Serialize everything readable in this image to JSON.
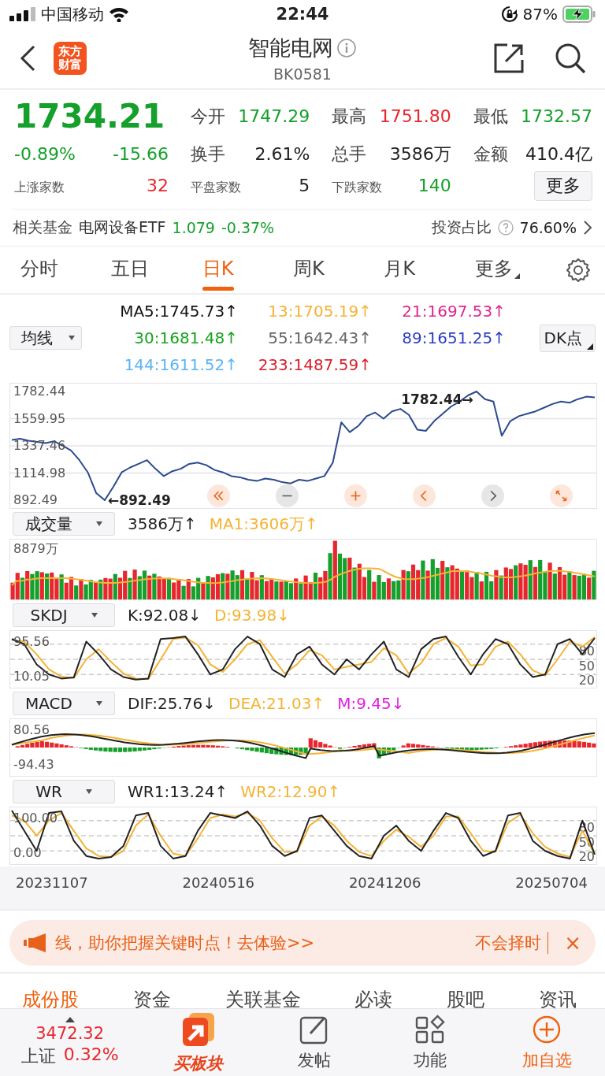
{
  "status_bar": {
    "carrier": "中国移动",
    "time": "22:44",
    "battery": "87%"
  },
  "header": {
    "logo": "东方财富",
    "title": "智能电网",
    "code": "BK0581"
  },
  "quote": {
    "price": "1734.21",
    "color": "#15a02b",
    "change_pct": "-0.89%",
    "change": "-15.66",
    "stats": [
      {
        "label": "今开",
        "value": "1747.29",
        "color": "#15a02b"
      },
      {
        "label": "最高",
        "value": "1751.80",
        "color": "#e8262d"
      },
      {
        "label": "最低",
        "value": "1732.57",
        "color": "#15a02b"
      },
      {
        "label": "换手",
        "value": "2.61%",
        "color": "#222222"
      },
      {
        "label": "总手",
        "value": "3586万",
        "color": "#222222"
      },
      {
        "label": "金额",
        "value": "410.4亿",
        "color": "#222222"
      }
    ],
    "counts": [
      {
        "label": "上涨家数",
        "value": "32",
        "color": "#e8262d"
      },
      {
        "label": "平盘家数",
        "value": "5",
        "color": "#222222"
      },
      {
        "label": "下跌家数",
        "value": "140",
        "color": "#15a02b"
      }
    ],
    "more_button": "更多"
  },
  "fund": {
    "label": "相关基金",
    "name": "电网设备ETF",
    "price": "1.079",
    "change": "-0.37%",
    "ratio_label": "投资占比",
    "ratio": "76.60%"
  },
  "tabs": [
    {
      "label": "分时",
      "selected": false
    },
    {
      "label": "五日",
      "selected": false
    },
    {
      "label": "日K",
      "selected": true
    },
    {
      "label": "周K",
      "selected": false
    },
    {
      "label": "月K",
      "selected": false
    },
    {
      "label": "更多",
      "selected": false
    }
  ],
  "ma": {
    "selector": "均线",
    "button": "DK点",
    "items": [
      {
        "text": "MA5:1745.73↑",
        "color": "#111111"
      },
      {
        "text": "13:1705.19↑",
        "color": "#f5b335"
      },
      {
        "text": "21:1697.53↑",
        "color": "#e0248c"
      },
      {
        "text": "30:1681.48↑",
        "color": "#16a31e"
      },
      {
        "text": "55:1642.43↑",
        "color": "#666666"
      },
      {
        "text": "89:1651.25↑",
        "color": "#2c3fc4"
      },
      {
        "text": "144:1611.52↑",
        "color": "#5ab4f5"
      },
      {
        "text": "233:1487.59↑",
        "color": "#d9202c"
      }
    ]
  },
  "price_chart": {
    "max_label": "1782.44→",
    "min_label": "←892.49",
    "chart_data": {
      "type": "line",
      "grid": true,
      "ylim": [
        828,
        1847
      ],
      "yticks": [
        1782.44,
        1559.95,
        1337.46,
        1114.98,
        892.49
      ],
      "series": [
        {
          "color": "#2b4a8e",
          "values": [
            1385,
            1395,
            1380,
            1370,
            1360,
            1375,
            1340,
            1300,
            1220,
            1120,
            950,
            892.49,
            1000,
            1120,
            1160,
            1190,
            1220,
            1150,
            1090,
            1130,
            1150,
            1190,
            1200,
            1180,
            1140,
            1120,
            1090,
            1080,
            1060,
            1050,
            1070,
            1060,
            1040,
            1030,
            1060,
            1050,
            1070,
            1090,
            1200,
            1530,
            1450,
            1500,
            1580,
            1610,
            1560,
            1620,
            1640,
            1590,
            1470,
            1460,
            1540,
            1600,
            1660,
            1700,
            1750,
            1782.44,
            1720,
            1700,
            1420,
            1540,
            1580,
            1600,
            1620,
            1650,
            1680,
            1700,
            1690,
            1720,
            1740,
            1734.21
          ]
        }
      ]
    }
  },
  "indicators": [
    {
      "kind": "volume",
      "name": "成交量",
      "readings": [
        {
          "text": "3586万↑",
          "color": "#222222"
        },
        {
          "text": "MA1:3606万↑",
          "color": "#f5b335"
        }
      ],
      "left_labels": [
        "8879万"
      ]
    },
    {
      "kind": "oscillator",
      "name": "SKDJ",
      "readings": [
        {
          "text": "K:92.08↓",
          "color": "#222222"
        },
        {
          "text": "D:93.98↓",
          "color": "#f5b335"
        }
      ],
      "left_labels": [
        "95.56",
        "10.05"
      ],
      "chart_data": {
        "type": "line",
        "grid": true,
        "ylim": [
          -6,
          106
        ],
        "yticks": [
          80,
          50,
          20
        ],
        "series": [
          {
            "color": "#222222",
            "values": [
              90,
              80,
              40,
              20,
              12,
              14,
              85,
              60,
              30,
              15,
              10,
              12,
              90,
              92,
              95,
              60,
              20,
              30,
              70,
              95,
              80,
              30,
              15,
              60,
              75,
              40,
              20,
              50,
              30,
              60,
              85,
              30,
              15,
              70,
              90,
              95,
              55,
              20,
              60,
              90,
              80,
              40,
              15,
              20,
              80,
              90,
              60,
              92
            ]
          },
          {
            "color": "#f5b335",
            "values": [
              88,
              85,
              60,
              30,
              16,
              13,
              50,
              70,
              45,
              22,
              12,
              11,
              50,
              90,
              93,
              78,
              40,
              25,
              50,
              80,
              88,
              55,
              22,
              40,
              68,
              58,
              30,
              35,
              40,
              45,
              72,
              58,
              22,
              42,
              80,
              92,
              75,
              38,
              40,
              75,
              85,
              60,
              28,
              18,
              50,
              85,
              75,
              94
            ]
          }
        ]
      }
    },
    {
      "kind": "macd",
      "name": "MACD",
      "readings": [
        {
          "text": "DIF:25.76↓",
          "color": "#222222"
        },
        {
          "text": "DEA:21.03↑",
          "color": "#f5b335"
        },
        {
          "text": "M:9.45↓",
          "color": "#e020e0"
        }
      ],
      "left_labels": [
        "80.56",
        "-94.43"
      ]
    },
    {
      "kind": "oscillator",
      "name": "WR",
      "readings": [
        {
          "text": "WR1:13.24↑",
          "color": "#222222"
        },
        {
          "text": "WR2:12.90↑",
          "color": "#f5b335"
        }
      ],
      "left_labels": [
        "100.00",
        "0.00"
      ],
      "chart_data": {
        "type": "line",
        "grid": true,
        "ylim": [
          -6,
          106
        ],
        "yticks": [
          80,
          50,
          20
        ],
        "series": [
          {
            "color": "#222222",
            "values": [
              100,
              60,
              20,
              95,
              98,
              40,
              10,
              5,
              8,
              30,
              90,
              95,
              30,
              5,
              10,
              60,
              95,
              90,
              85,
              98,
              70,
              30,
              10,
              20,
              85,
              90,
              60,
              30,
              10,
              5,
              50,
              70,
              40,
              20,
              60,
              95,
              85,
              40,
              10,
              20,
              90,
              95,
              40,
              20,
              10,
              5,
              80,
              13
            ]
          },
          {
            "color": "#f5b335",
            "values": [
              90,
              80,
              50,
              80,
              95,
              60,
              25,
              10,
              8,
              20,
              70,
              92,
              50,
              15,
              10,
              45,
              85,
              92,
              88,
              95,
              80,
              45,
              18,
              18,
              70,
              88,
              70,
              40,
              18,
              10,
              40,
              62,
              48,
              28,
              50,
              88,
              88,
              55,
              20,
              18,
              75,
              92,
              55,
              28,
              15,
              8,
              60,
              13
            ]
          }
        ]
      }
    }
  ],
  "dates": [
    "20231107",
    "20240516",
    "20241206",
    "20250704"
  ],
  "banner": {
    "text": "线，助你把握关键时点！去体验>>",
    "tail": "不会择时",
    "close": "×"
  },
  "section_tabs": [
    {
      "label": "成份股",
      "selected": true
    },
    {
      "label": "资金",
      "selected": false
    },
    {
      "label": "关联基金",
      "selected": false
    },
    {
      "label": "必读",
      "selected": false
    },
    {
      "label": "股吧",
      "selected": false
    },
    {
      "label": "资讯",
      "selected": false
    }
  ],
  "bottom_bar": {
    "index": {
      "value": "3472.32",
      "name": "上证",
      "change": "0.32%",
      "color": "#e8262d"
    },
    "items": [
      {
        "kind": "brand",
        "label": "买板块"
      },
      {
        "kind": "post",
        "label": "发帖"
      },
      {
        "kind": "grid",
        "label": "功能"
      },
      {
        "kind": "add",
        "label": "加自选"
      }
    ]
  }
}
